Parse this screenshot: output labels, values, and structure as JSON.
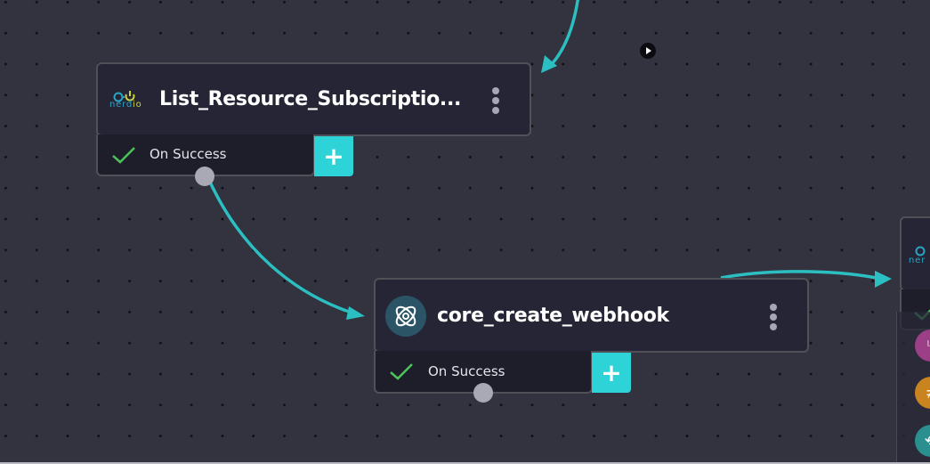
{
  "canvas": {
    "background_color": "#33333f",
    "edge_color": "#2bbfc1"
  },
  "nodes": [
    {
      "id": "list-resource-subscriptions",
      "title": "List_Resource_Subscriptio...",
      "icon": "nerdio-logo",
      "logo_text_main": "nerd",
      "logo_text_accent": "io",
      "outputs": [
        {
          "label": "On Success",
          "status_icon": "check-icon"
        }
      ],
      "add_label": "+"
    },
    {
      "id": "core-create-webhook",
      "title": "core_create_webhook",
      "icon": "atom-icon",
      "outputs": [
        {
          "label": "On Success",
          "status_icon": "check-icon"
        }
      ],
      "add_label": "+"
    },
    {
      "id": "right-partial-node",
      "title": "",
      "icon": "nerdio-logo",
      "logo_text_main": "ner",
      "logo_text_accent": ""
    }
  ],
  "side_panel": {
    "tools": [
      {
        "name": "branch-icon",
        "glyph": "⑂",
        "color": "#9c3f86"
      },
      {
        "name": "not-equal-icon",
        "glyph": "≠",
        "color": "#c9841f"
      },
      {
        "name": "loop-icon",
        "glyph": "⟲",
        "color": "#2a8f8f"
      }
    ]
  },
  "colors": {
    "accent": "#2dd3d7",
    "success": "#4cc35a",
    "node_bg": "#252535",
    "footer_bg": "#1e1e2a"
  }
}
